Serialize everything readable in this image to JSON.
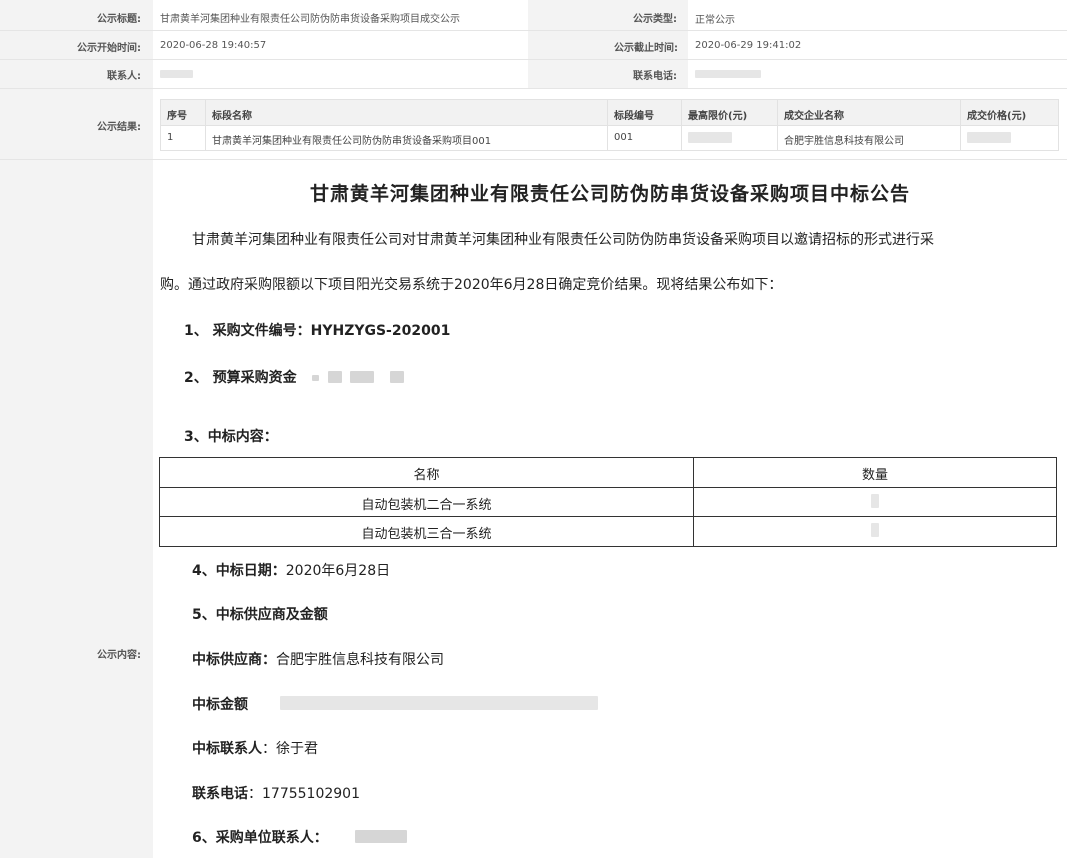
{
  "info": {
    "title_label": "公示标题:",
    "title_value": "甘肃黄羊河集团种业有限责任公司防伪防串货设备采购项目成交公示",
    "type_label": "公示类型:",
    "type_value": "正常公示",
    "start_label": "公示开始时间:",
    "start_value": "2020-06-28 19:40:57",
    "end_label": "公示截止时间:",
    "end_value": "2020-06-29 19:41:02",
    "contact_label": "联系人:",
    "phone_label": "联系电话:",
    "result_label": "公示结果:",
    "content_label": "公示内容:"
  },
  "results": {
    "headers": [
      "序号",
      "标段名称",
      "标段编号",
      "最高限价(元)",
      "成交企业名称",
      "成交价格(元)"
    ],
    "row": {
      "index": "1",
      "name": "甘肃黄羊河集团种业有限责任公司防伪防串货设备采购项目001",
      "code": "001",
      "company": "合肥宇胜信息科技有限公司"
    }
  },
  "notice": {
    "heading": "甘肃黄羊河集团种业有限责任公司防伪防串货设备采购项目中标公告",
    "intro_line1": "甘肃黄羊河集团种业有限责任公司对甘肃黄羊河集团种业有限责任公司防伪防串货设备采购项目以邀请招标的形式进行采",
    "intro_line2": "购。通过政府采购限额以下项目阳光交易系统于2020年6月28日确定竞价结果。现将结果公布如下：",
    "item1_num": "1、",
    "item1_label": "采购文件编号：",
    "item1_value": "HYHZYGS-202001",
    "item2_num": "2、",
    "item2_label": "预算采购资金",
    "item3": "3、中标内容：",
    "table_headers": [
      "名称",
      "数量"
    ],
    "table_rows": [
      "自动包装机二合一系统",
      "自动包装机三合一系统"
    ],
    "item4_label": "4、中标日期：",
    "item4_value": "2020年6月28日",
    "item5": "5、中标供应商及金额",
    "supplier_label": "中标供应商：",
    "supplier_value": "合肥宇胜信息科技有限公司",
    "amount_label": "中标金额",
    "win_contact_label": "中标联系人",
    "win_contact_value": "：徐于君",
    "win_phone_label": "联系电话",
    "win_phone_value": "：17755102901",
    "item6": "6、采购单位联系人："
  }
}
